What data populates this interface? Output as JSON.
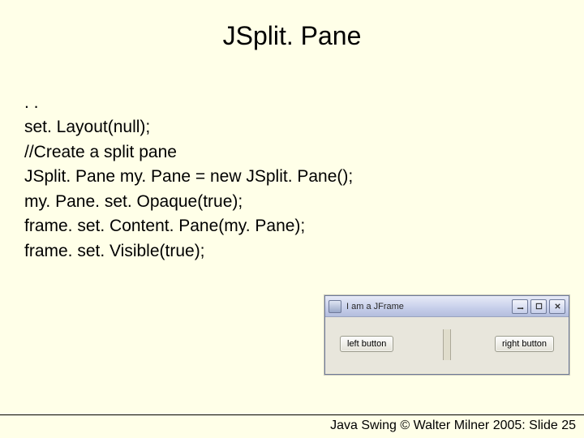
{
  "title": "JSplit. Pane",
  "code_lines": [
    ". .",
    "set. Layout(null);",
    "//Create a split pane",
    "JSplit. Pane my. Pane = new JSplit. Pane();",
    "my. Pane. set. Opaque(true);",
    "frame. set. Content. Pane(my. Pane);",
    "frame. set. Visible(true);"
  ],
  "jframe": {
    "title": "I am a JFrame",
    "left_button": "left button",
    "right_button": "right button"
  },
  "footer": "Java Swing © Walter Milner 2005: Slide 25"
}
